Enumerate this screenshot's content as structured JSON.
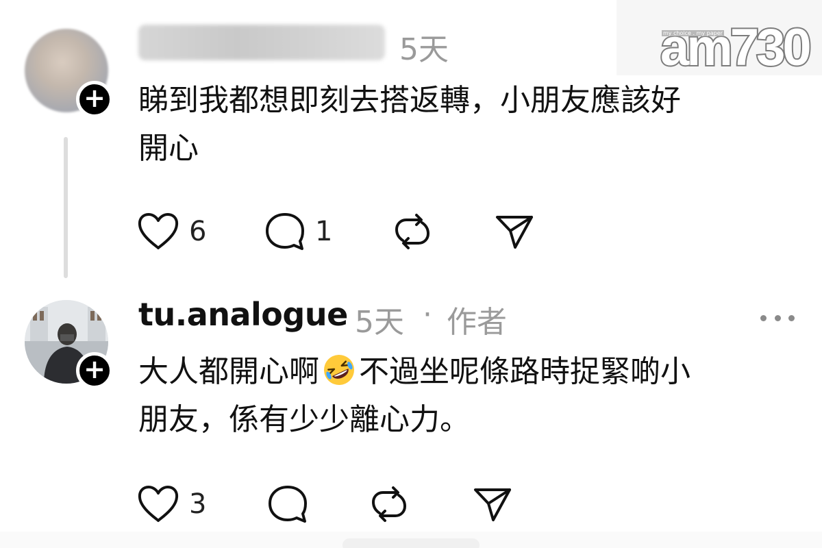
{
  "comments": [
    {
      "username": "",
      "time": "5天",
      "text_line1": "睇到我都想即刻去搭返轉，小朋友應該好",
      "text_line2": "開心",
      "likes": "6",
      "replies": "1",
      "avatar_icon": "blurred-profile-photo",
      "follow_icon": "plus-icon"
    },
    {
      "username": "tu.analogue",
      "time": "5天",
      "separator": "·",
      "author_tag": "作者",
      "text_line1_before_emoji": "大人都開心啊",
      "emoji_icon": "rolling-on-floor-laughing-emoji",
      "text_line1_after_emoji": "不過坐呢條路時捉緊啲小",
      "text_line2": "朋友，係有少少離心力。",
      "likes": "3",
      "avatar_icon": "photographer-profile-photo",
      "follow_icon": "plus-icon"
    }
  ],
  "watermark": {
    "small_text": "my choice . my paper",
    "logo_text": "am730"
  },
  "icons": {
    "like": "heart-icon",
    "reply": "comment-bubble-icon",
    "repost": "repost-icon",
    "share": "send-icon",
    "more": "more-dots-icon"
  },
  "colors": {
    "text": "#111111",
    "meta": "#9a9a9a",
    "badge": "#000000",
    "thread_line": "#dddddd"
  }
}
